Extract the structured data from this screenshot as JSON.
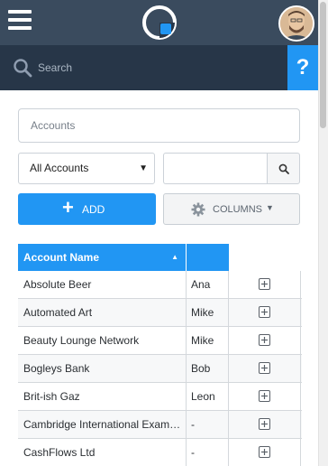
{
  "search": {
    "placeholder": "Search"
  },
  "help": {
    "label": "?"
  },
  "page": {
    "title": "Accounts"
  },
  "filter": {
    "selected": "All Accounts",
    "caret": "▼",
    "text_value": ""
  },
  "buttons": {
    "add_label": "ADD",
    "add_icon": "+",
    "columns_label": "COLUMNS",
    "columns_caret": "▼"
  },
  "table": {
    "headers": {
      "account_name": "Account Name",
      "sort_indicator": "▲",
      "owner": ""
    },
    "rows": [
      {
        "name": "Absolute Beer",
        "owner": "Ana"
      },
      {
        "name": "Automated Art",
        "owner": "Mike"
      },
      {
        "name": "Beauty Lounge Network",
        "owner": "Mike"
      },
      {
        "name": "Bogleys Bank",
        "owner": "Bob"
      },
      {
        "name": "Brit-ish Gaz",
        "owner": "Leon"
      },
      {
        "name": "Cambridge International Examinations",
        "owner": "-"
      },
      {
        "name": "CashFlows Ltd",
        "owner": "-"
      }
    ]
  },
  "colors": {
    "topbar": "#3a4b5e",
    "searchbar": "#273648",
    "accent": "#2196f3"
  },
  "icons": {
    "menu": "hamburger-menu-icon",
    "logo": "app-logo-icon",
    "avatar": "user-avatar",
    "search": "search-icon",
    "gear": "gear-icon",
    "expand": "plus-square-icon"
  }
}
